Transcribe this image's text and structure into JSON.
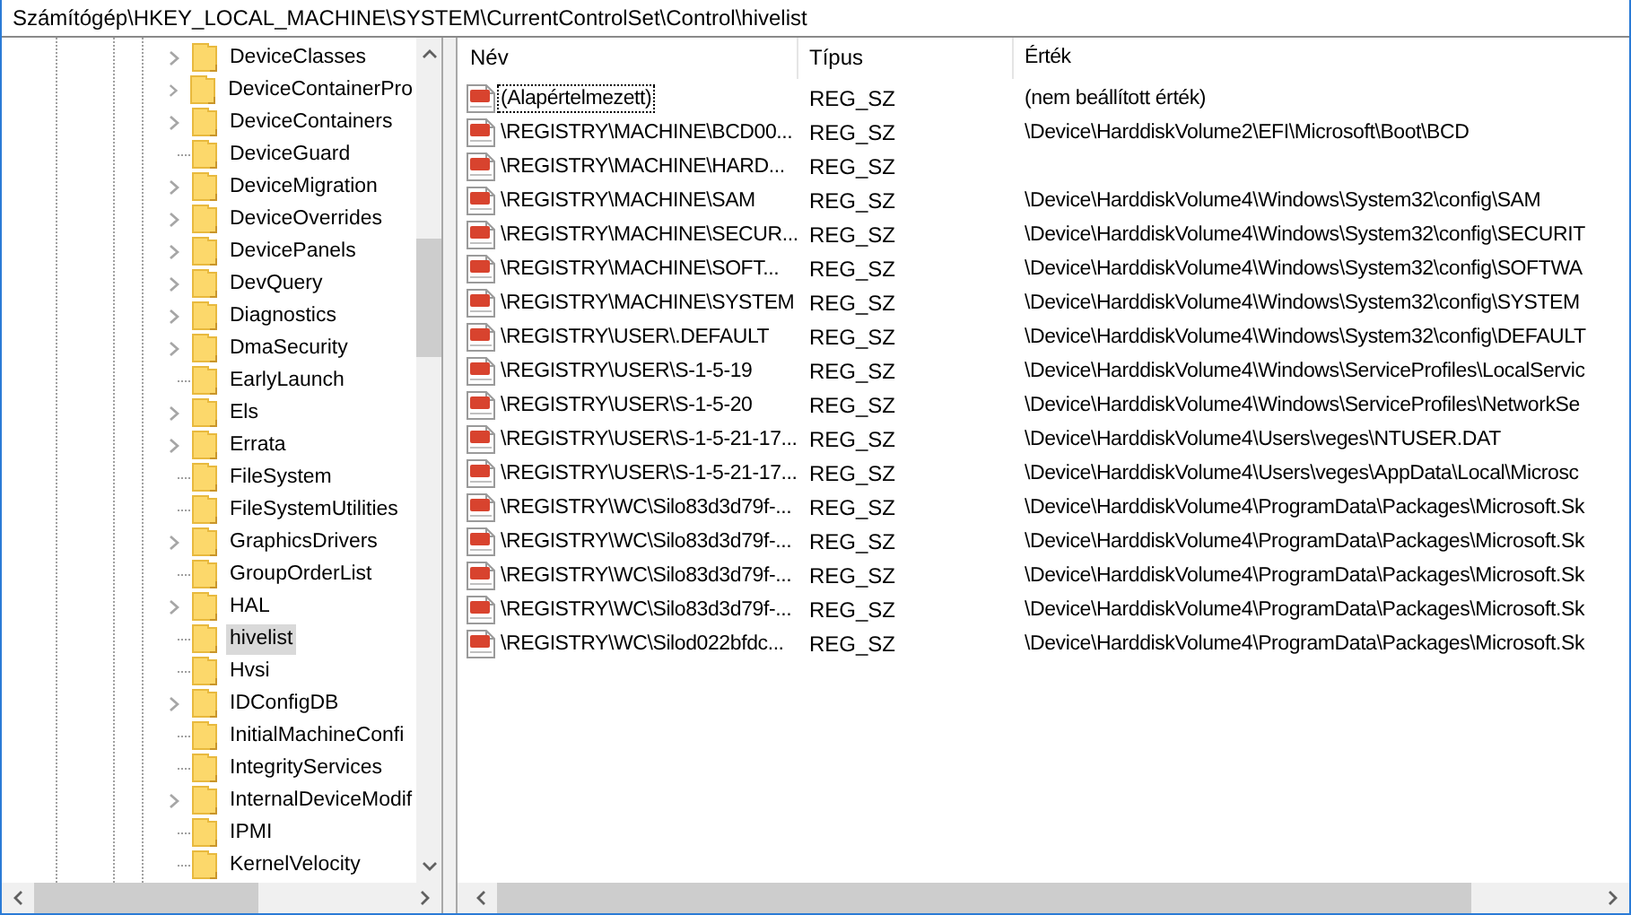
{
  "address_bar": {
    "path": "Számítógép\\HKEY_LOCAL_MACHINE\\SYSTEM\\CurrentControlSet\\Control\\hivelist"
  },
  "tree": {
    "items": [
      {
        "label": "DeviceClasses",
        "expandable": true,
        "selected": false
      },
      {
        "label": "DeviceContainerPro",
        "expandable": true,
        "selected": false
      },
      {
        "label": "DeviceContainers",
        "expandable": true,
        "selected": false
      },
      {
        "label": "DeviceGuard",
        "expandable": false,
        "selected": false
      },
      {
        "label": "DeviceMigration",
        "expandable": true,
        "selected": false
      },
      {
        "label": "DeviceOverrides",
        "expandable": true,
        "selected": false
      },
      {
        "label": "DevicePanels",
        "expandable": true,
        "selected": false
      },
      {
        "label": "DevQuery",
        "expandable": true,
        "selected": false
      },
      {
        "label": "Diagnostics",
        "expandable": true,
        "selected": false
      },
      {
        "label": "DmaSecurity",
        "expandable": true,
        "selected": false
      },
      {
        "label": "EarlyLaunch",
        "expandable": false,
        "selected": false
      },
      {
        "label": "Els",
        "expandable": true,
        "selected": false
      },
      {
        "label": "Errata",
        "expandable": true,
        "selected": false
      },
      {
        "label": "FileSystem",
        "expandable": false,
        "selected": false
      },
      {
        "label": "FileSystemUtilities",
        "expandable": false,
        "selected": false
      },
      {
        "label": "GraphicsDrivers",
        "expandable": true,
        "selected": false
      },
      {
        "label": "GroupOrderList",
        "expandable": false,
        "selected": false
      },
      {
        "label": "HAL",
        "expandable": true,
        "selected": false
      },
      {
        "label": "hivelist",
        "expandable": false,
        "selected": true
      },
      {
        "label": "Hvsi",
        "expandable": false,
        "selected": false
      },
      {
        "label": "IDConfigDB",
        "expandable": true,
        "selected": false
      },
      {
        "label": "InitialMachineConfi",
        "expandable": false,
        "selected": false
      },
      {
        "label": "IntegrityServices",
        "expandable": false,
        "selected": false
      },
      {
        "label": "InternalDeviceModif",
        "expandable": true,
        "selected": false
      },
      {
        "label": "IPMI",
        "expandable": false,
        "selected": false
      },
      {
        "label": "KernelVelocity",
        "expandable": false,
        "selected": false
      }
    ]
  },
  "table": {
    "columns": [
      "Név",
      "Típus",
      "Érték"
    ],
    "rows": [
      {
        "name": "(Alapértelmezett)",
        "type": "REG_SZ",
        "value": "(nem beállított érték)",
        "focused": true
      },
      {
        "name": "\\REGISTRY\\MACHINE\\BCD00...",
        "type": "REG_SZ",
        "value": "\\Device\\HarddiskVolume2\\EFI\\Microsoft\\Boot\\BCD",
        "focused": false
      },
      {
        "name": "\\REGISTRY\\MACHINE\\HARD...",
        "type": "REG_SZ",
        "focused": false
      },
      {
        "name": "\\REGISTRY\\MACHINE\\SAM",
        "type": "REG_SZ",
        "value": "\\Device\\HarddiskVolume4\\Windows\\System32\\config\\SAM",
        "focused": false
      },
      {
        "name": "\\REGISTRY\\MACHINE\\SECUR...",
        "type": "REG_SZ",
        "value": "\\Device\\HarddiskVolume4\\Windows\\System32\\config\\SECURIT",
        "focused": false
      },
      {
        "name": "\\REGISTRY\\MACHINE\\SOFT...",
        "type": "REG_SZ",
        "value": "\\Device\\HarddiskVolume4\\Windows\\System32\\config\\SOFTWA",
        "focused": false
      },
      {
        "name": "\\REGISTRY\\MACHINE\\SYSTEM",
        "type": "REG_SZ",
        "value": "\\Device\\HarddiskVolume4\\Windows\\System32\\config\\SYSTEM",
        "focused": false
      },
      {
        "name": "\\REGISTRY\\USER\\.DEFAULT",
        "type": "REG_SZ",
        "value": "\\Device\\HarddiskVolume4\\Windows\\System32\\config\\DEFAULT",
        "focused": false
      },
      {
        "name": "\\REGISTRY\\USER\\S-1-5-19",
        "type": "REG_SZ",
        "value": "\\Device\\HarddiskVolume4\\Windows\\ServiceProfiles\\LocalServic",
        "focused": false
      },
      {
        "name": "\\REGISTRY\\USER\\S-1-5-20",
        "type": "REG_SZ",
        "value": "\\Device\\HarddiskVolume4\\Windows\\ServiceProfiles\\NetworkSe",
        "focused": false
      },
      {
        "name": "\\REGISTRY\\USER\\S-1-5-21-17...",
        "type": "REG_SZ",
        "value": "\\Device\\HarddiskVolume4\\Users\\veges\\NTUSER.DAT",
        "focused": false
      },
      {
        "name": "\\REGISTRY\\USER\\S-1-5-21-17...",
        "type": "REG_SZ",
        "value": "\\Device\\HarddiskVolume4\\Users\\veges\\AppData\\Local\\Microsc",
        "focused": false
      },
      {
        "name": "\\REGISTRY\\WC\\Silo83d3d79f-...",
        "type": "REG_SZ",
        "value": "\\Device\\HarddiskVolume4\\ProgramData\\Packages\\Microsoft.Sk",
        "focused": false
      },
      {
        "name": "\\REGISTRY\\WC\\Silo83d3d79f-...",
        "type": "REG_SZ",
        "value": "\\Device\\HarddiskVolume4\\ProgramData\\Packages\\Microsoft.Sk",
        "focused": false
      },
      {
        "name": "\\REGISTRY\\WC\\Silo83d3d79f-...",
        "type": "REG_SZ",
        "value": "\\Device\\HarddiskVolume4\\ProgramData\\Packages\\Microsoft.Sk",
        "focused": false
      },
      {
        "name": "\\REGISTRY\\WC\\Silo83d3d79f-...",
        "type": "REG_SZ",
        "value": "\\Device\\HarddiskVolume4\\ProgramData\\Packages\\Microsoft.Sk",
        "focused": false
      },
      {
        "name": "\\REGISTRY\\WC\\Silod022bfdc...",
        "type": "REG_SZ",
        "value": "\\Device\\HarddiskVolume4\\ProgramData\\Packages\\Microsoft.Sk",
        "focused": false
      }
    ]
  }
}
